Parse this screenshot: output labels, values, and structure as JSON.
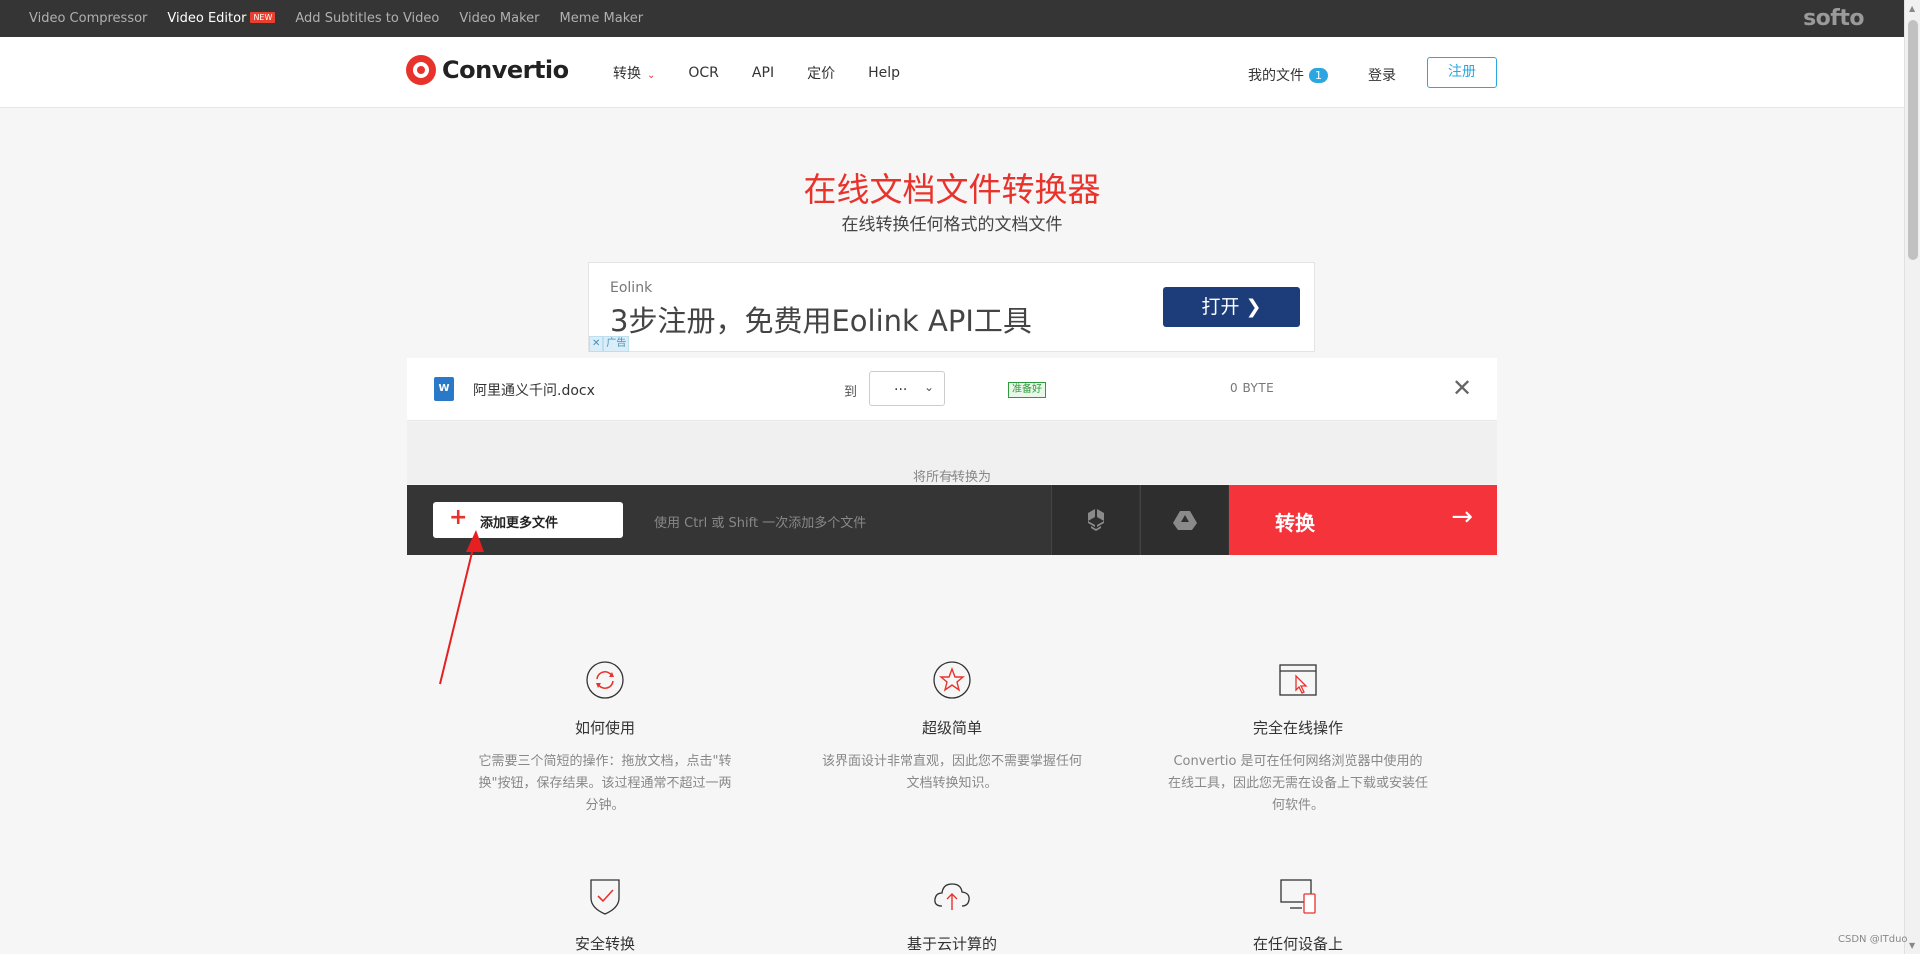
{
  "topbar": {
    "links": [
      "Video Compressor",
      "Video Editor",
      "Add Subtitles to Video",
      "Video Maker",
      "Meme Maker"
    ],
    "new_badge": "NEW",
    "brand": "softo"
  },
  "header": {
    "logo": "Convertio",
    "nav": [
      "转换",
      "OCR",
      "API",
      "定价",
      "Help"
    ],
    "my_files": "我的文件",
    "my_files_count": "1",
    "login": "登录",
    "signup": "注册",
    "accent_color": "#e8332c",
    "link_color": "#2aa7e0"
  },
  "hero": {
    "title": "在线文档文件转换器",
    "subtitle": "在线转换任何格式的文档文件"
  },
  "ad": {
    "brand": "Eolink",
    "headline": "3步注册，免费用Eolink API工具",
    "button": "打开",
    "close_mark": "✕",
    "ad_label": "广告"
  },
  "file": {
    "name": "阿里通义千问.docx",
    "to_label": "到",
    "format_value": "...",
    "status": "准备好",
    "size": "0 BYTE"
  },
  "convert_all": {
    "label": "将所有转换为"
  },
  "toolbar": {
    "add_more": "添加更多文件",
    "hint": "使用 Ctrl 或 Shift 一次添加多个文件",
    "convert": "转换",
    "convert_color": "#f4333b"
  },
  "features": [
    {
      "title": "如何使用",
      "desc": "它需要三个简短的操作：拖放文档，点击\"转换\"按钮，保存结果。该过程通常不超过一两分钟。",
      "icon": "refresh-icon"
    },
    {
      "title": "超级简单",
      "desc": "该界面设计非常直观，因此您不需要掌握任何文档转换知识。",
      "icon": "star-icon"
    },
    {
      "title": "完全在线操作",
      "desc": "Convertio 是可在任何网络浏览器中使用的在线工具，因此您无需在设备上下载或安装任何软件。",
      "icon": "browser-cursor-icon"
    },
    {
      "title": "安全转换",
      "icon": "shield-check-icon"
    },
    {
      "title": "基于云计算的",
      "icon": "cloud-upload-icon"
    },
    {
      "title": "在任何设备上",
      "icon": "devices-icon"
    }
  ],
  "watermark": "CSDN @ITduo"
}
